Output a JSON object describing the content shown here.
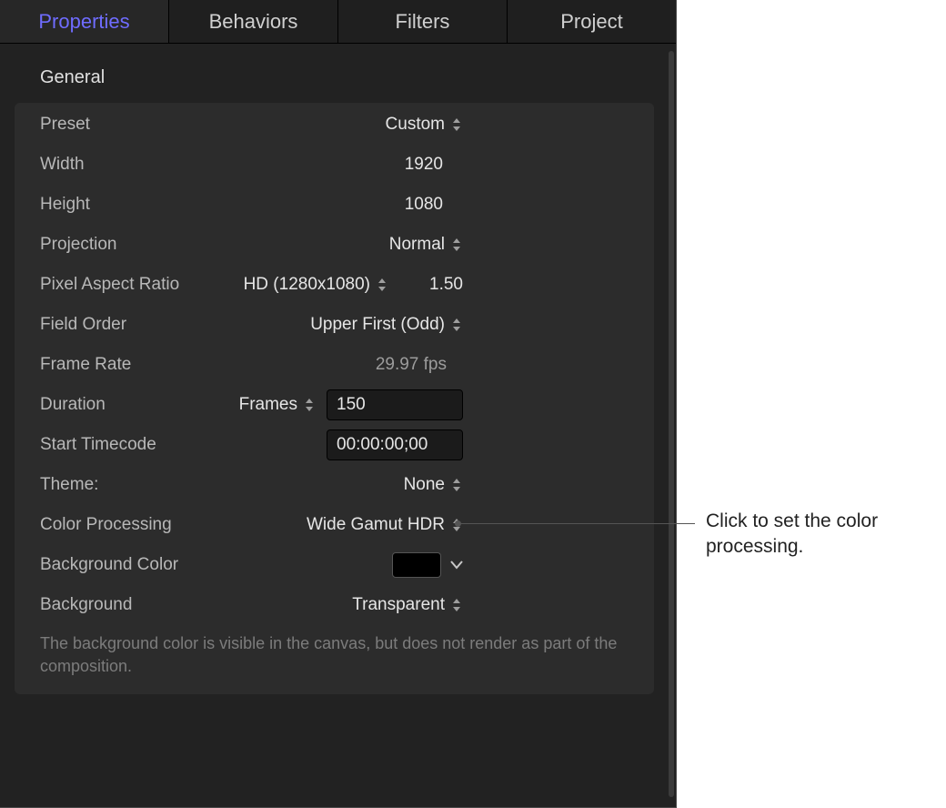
{
  "tabs": {
    "items": [
      {
        "id": "properties",
        "label": "Properties",
        "active": true
      },
      {
        "id": "behaviors",
        "label": "Behaviors",
        "active": false
      },
      {
        "id": "filters",
        "label": "Filters",
        "active": false
      },
      {
        "id": "project",
        "label": "Project",
        "active": false
      }
    ]
  },
  "section": {
    "title": "General",
    "note": "The background color is visible in the canvas, but does not render as part of the composition."
  },
  "props": {
    "preset": {
      "label": "Preset",
      "value": "Custom"
    },
    "width": {
      "label": "Width",
      "value": "1920"
    },
    "height": {
      "label": "Height",
      "value": "1080"
    },
    "projection": {
      "label": "Projection",
      "value": "Normal"
    },
    "par": {
      "label": "Pixel Aspect Ratio",
      "preset": "HD (1280x1080)",
      "value": "1.50"
    },
    "field_order": {
      "label": "Field Order",
      "value": "Upper First (Odd)"
    },
    "frame_rate": {
      "label": "Frame Rate",
      "value": "29.97 fps"
    },
    "duration": {
      "label": "Duration",
      "unit": "Frames",
      "value": "150"
    },
    "start_tc": {
      "label": "Start Timecode",
      "value": "00:00:00;00"
    },
    "theme": {
      "label": "Theme:",
      "value": "None"
    },
    "color_processing": {
      "label": "Color Processing",
      "value": "Wide Gamut HDR"
    },
    "bg_color": {
      "label": "Background Color",
      "color": "#000000"
    },
    "background": {
      "label": "Background",
      "value": "Transparent"
    }
  },
  "callout": {
    "text": "Click to set the color processing."
  }
}
